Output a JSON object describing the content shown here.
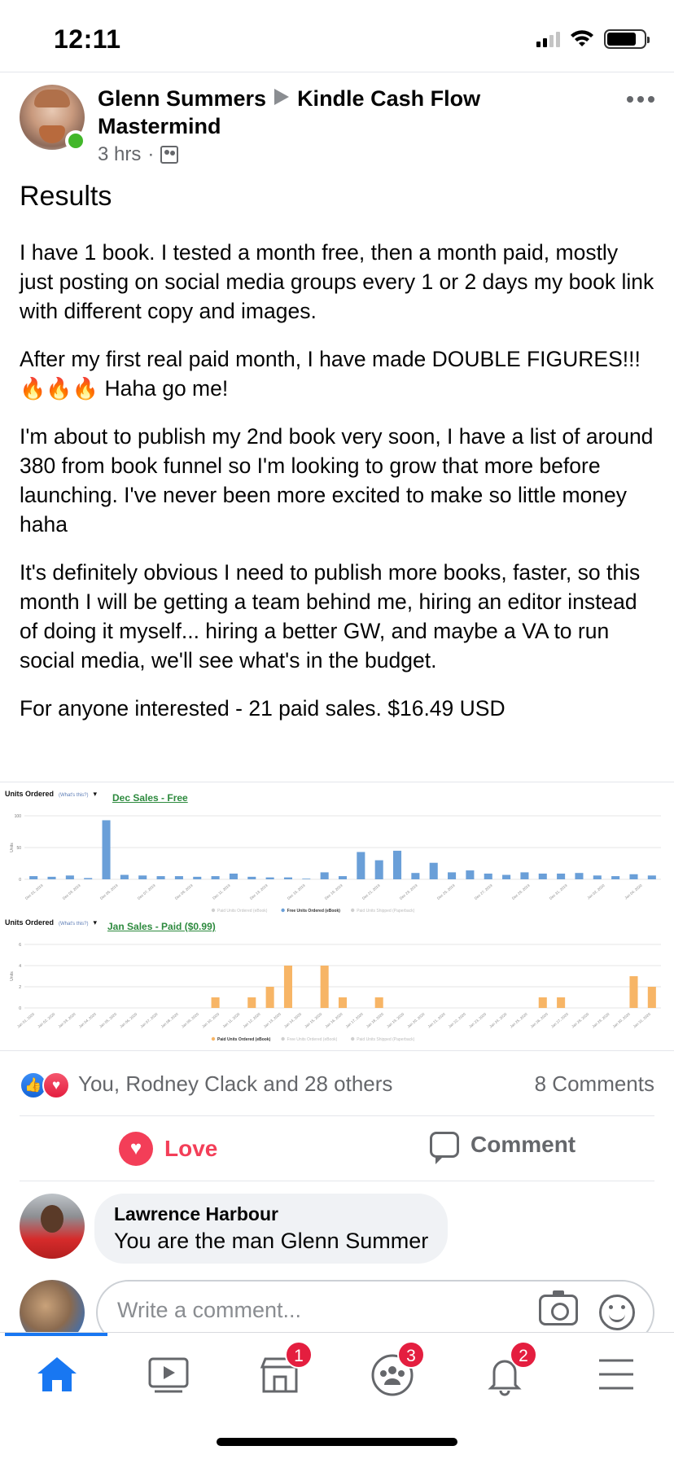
{
  "status_bar": {
    "time": "12:11"
  },
  "post": {
    "author": "Glenn Summers",
    "group": "Kindle Cash Flow Mastermind",
    "time_ago": "3 hrs",
    "title": "Results",
    "paragraphs": [
      "I have 1 book. I tested a month free, then a month paid, mostly just posting on social media groups every 1 or 2 days my book link with different copy and images.",
      "After my first real paid month, I have made DOUBLE FIGURES!!!",
      "🔥🔥🔥",
      "Haha go me!",
      "I'm about to publish my 2nd book very soon, I have a list of around 380 from book funnel so I'm looking to grow that more before launching. I've never been more excited to make so little money haha",
      "It's definitely obvious I need to publish more books, faster, so this month I will be getting a team behind me, hiring an editor instead of doing it myself... hiring a better GW, and maybe a VA to run social media, we'll see what's in the budget.",
      "For anyone interested - 21 paid sales. $16.49 USD"
    ]
  },
  "chart_data": [
    {
      "type": "bar",
      "header": "Units Ordered",
      "header_sub": "(What's this?)",
      "title": "Dec Sales - Free",
      "ylabel": "Units",
      "ylim": [
        0,
        100
      ],
      "yticks": [
        "100",
        "50",
        "0"
      ],
      "series_color": "#6a9fd8",
      "series": [
        {
          "name": "Free Units Ordered (eBook)",
          "values": [
            5,
            4,
            6,
            2,
            93,
            7,
            6,
            5,
            5,
            4,
            5,
            9,
            4,
            3,
            3,
            1,
            11,
            5,
            43,
            30,
            45,
            10,
            26,
            11,
            14,
            9,
            7,
            11,
            9,
            9,
            10,
            6,
            5,
            8,
            6
          ]
        }
      ],
      "xticks": [
        "Dec 01, 2019",
        "Dec 03, 2019",
        "Dec 05, 2019",
        "Dec 07, 2019",
        "Dec 09, 2019",
        "Dec 11, 2019",
        "Dec 13, 2019",
        "Dec 15, 2019",
        "Dec 19, 2019",
        "Dec 21, 2019",
        "Dec 23, 2019",
        "Dec 25, 2019",
        "Dec 27, 2019",
        "Dec 29, 2019",
        "Dec 31, 2019",
        "Jan 02, 2020",
        "Jan 04, 2020"
      ],
      "legend": [
        "Paid Units Ordered (eBook)",
        "Free Units Ordered (eBook)",
        "Paid Units Shipped (Paperback)"
      ],
      "legend_active": 1
    },
    {
      "type": "bar",
      "header": "Units Ordered",
      "header_sub": "(What's this?)",
      "title": "Jan Sales - Paid ($0.99)",
      "ylabel": "Units",
      "ylim": [
        0,
        6
      ],
      "yticks": [
        "6",
        "4",
        "2",
        "0"
      ],
      "series_color": "#f7b566",
      "series": [
        {
          "name": "Paid Units Ordered (eBook)",
          "values": [
            0,
            0,
            0,
            0,
            0,
            0,
            0,
            0,
            0,
            0,
            1,
            0,
            1,
            2,
            4,
            0,
            4,
            1,
            0,
            1,
            0,
            0,
            0,
            0,
            0,
            0,
            0,
            0,
            1,
            1,
            0,
            0,
            0,
            3,
            2
          ]
        }
      ],
      "xticks": [
        "Jan 01, 2020",
        "Jan 02, 2020",
        "Jan 03, 2020",
        "Jan 04, 2020",
        "Jan 05, 2020",
        "Jan 06, 2020",
        "Jan 07, 2020",
        "Jan 08, 2020",
        "Jan 09, 2020",
        "Jan 10, 2020",
        "Jan 11, 2020",
        "Jan 12, 2020",
        "Jan 13, 2020",
        "Jan 14, 2020",
        "Jan 15, 2020",
        "Jan 16, 2020",
        "Jan 17, 2020",
        "Jan 18, 2020",
        "Jan 19, 2020",
        "Jan 20, 2020",
        "Jan 21, 2020",
        "Jan 22, 2020",
        "Jan 23, 2020",
        "Jan 24, 2020",
        "Jan 25, 2020",
        "Jan 26, 2020",
        "Jan 27, 2020",
        "Jan 28, 2020",
        "Jan 29, 2020",
        "Jan 30, 2020",
        "Jan 31, 2020"
      ],
      "legend": [
        "Paid Units Ordered (eBook)",
        "Free Units Ordered (eBook)",
        "Paid Units Shipped (Paperback)"
      ],
      "legend_active": 0
    }
  ],
  "reactions": {
    "summary": "You, Rodney Clack and 28 others",
    "comments": "8 Comments"
  },
  "actions": {
    "love": "Love",
    "comment": "Comment"
  },
  "comment": {
    "name": "Lawrence Harbour",
    "text": "You are the man Glenn Summer"
  },
  "composer": {
    "placeholder": "Write a comment..."
  },
  "tabs": [
    {
      "name": "home",
      "badge": null
    },
    {
      "name": "watch",
      "badge": null
    },
    {
      "name": "marketplace",
      "badge": "1"
    },
    {
      "name": "groups",
      "badge": "3"
    },
    {
      "name": "notifications",
      "badge": "2"
    },
    {
      "name": "menu",
      "badge": null
    }
  ],
  "colors": {
    "accent": "#1877f2",
    "love": "#f33e58",
    "badge": "#e41e3f",
    "online": "#42b72a"
  }
}
